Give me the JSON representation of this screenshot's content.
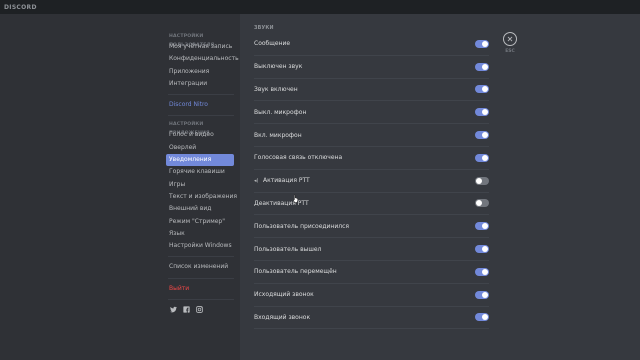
{
  "app": {
    "title": "DISCORD"
  },
  "sidebar": {
    "user_settings_header": "НАСТРОЙКИ ПОЛЬЗОВАТЕЛЯ",
    "user_items": [
      "Моя учётная запись",
      "Конфиденциальность",
      "Приложения",
      "Интеграции"
    ],
    "nitro": "Discord Nitro",
    "app_settings_header": "НАСТРОЙКИ ПРИЛОЖЕНИЯ",
    "app_items": [
      "Голос и видео",
      "Оверлей",
      "Уведомления",
      "Горячие клавиши",
      "Игры",
      "Текст и изображения",
      "Внешний вид",
      "Режим \"Стример\"",
      "Язык",
      "Настройки Windows"
    ],
    "changelog": "Список изменений",
    "logout": "Выйти",
    "social_icons": [
      "twitter-icon",
      "facebook-icon",
      "instagram-icon"
    ]
  },
  "content": {
    "section_title": "ЗВУКИ",
    "rows": [
      {
        "label": "Сообщение",
        "enabled": true
      },
      {
        "label": "Выключен звук",
        "enabled": true
      },
      {
        "label": "Звук включен",
        "enabled": true
      },
      {
        "label": "Выкл. микрофон",
        "enabled": true
      },
      {
        "label": "Вкл. микрофон",
        "enabled": true
      },
      {
        "label": "Голосовая связь отключена",
        "enabled": true
      },
      {
        "label": "Активация PTT",
        "enabled": false,
        "hover_icon": "speaker-icon"
      },
      {
        "label": "Деактивация PTT",
        "enabled": false
      },
      {
        "label": "Пользователь присоединился",
        "enabled": true
      },
      {
        "label": "Пользователь вышел",
        "enabled": true
      },
      {
        "label": "Пользователь перемещён",
        "enabled": true
      },
      {
        "label": "Исходящий звонок",
        "enabled": true
      },
      {
        "label": "Входящий звонок",
        "enabled": true
      }
    ]
  },
  "close": {
    "label": "ESC"
  },
  "colors": {
    "accent": "#7289da",
    "danger": "#f04747",
    "toggle_off": "#72767d",
    "sidebar_bg": "#2f3136",
    "content_bg": "#36393f"
  }
}
